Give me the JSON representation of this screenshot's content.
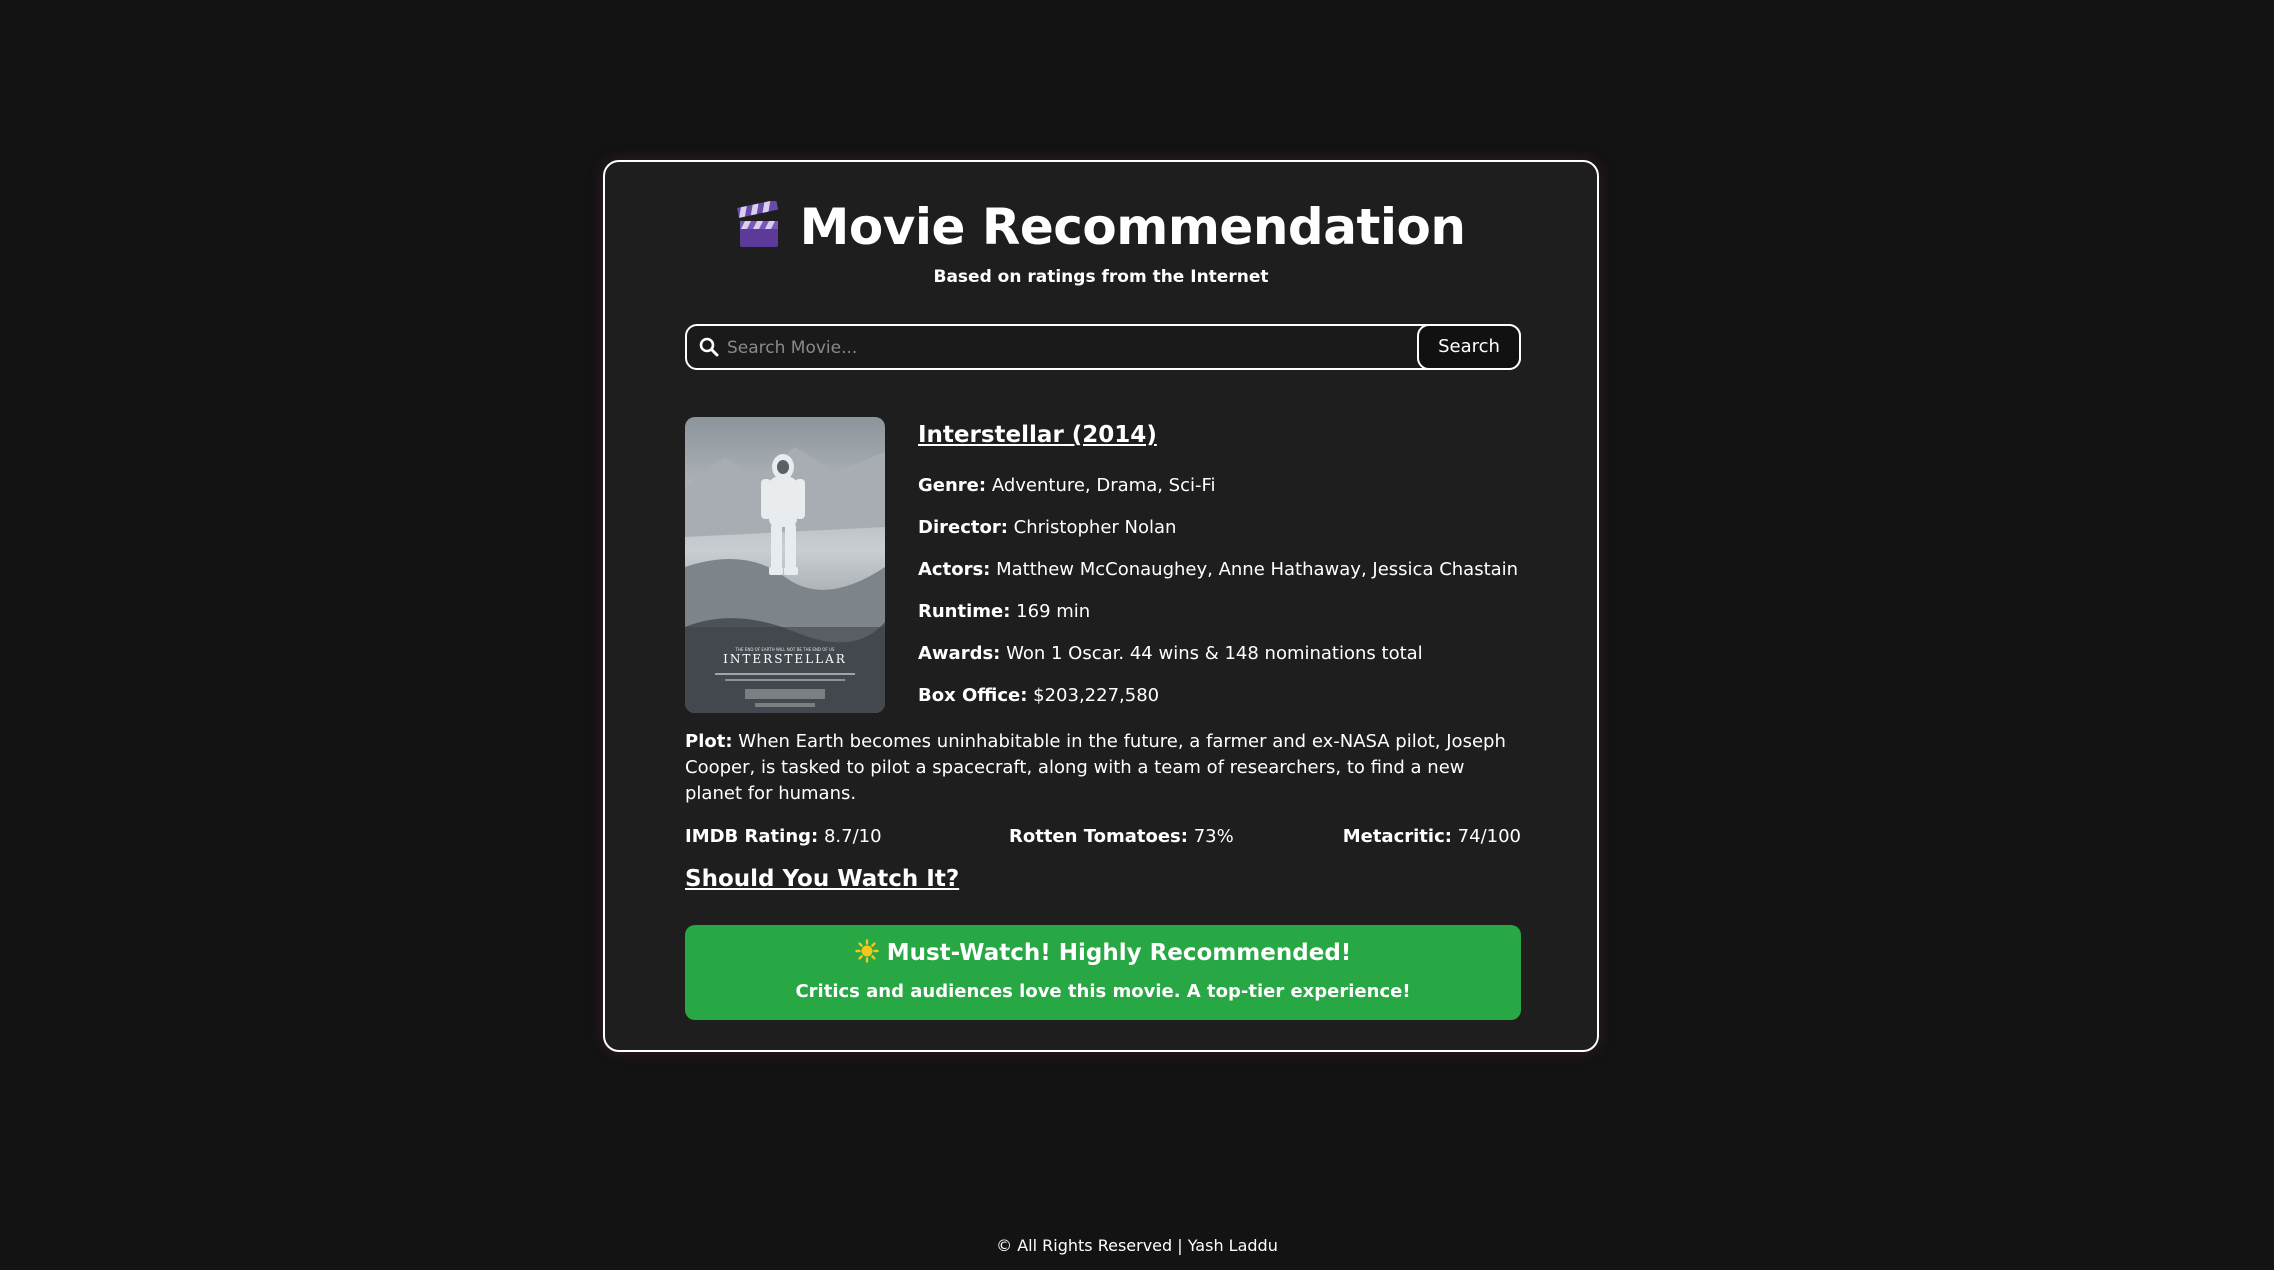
{
  "header": {
    "icon": "clapperboard-icon",
    "title": "Movie Recommendation",
    "subtitle": "Based on ratings from the Internet"
  },
  "search": {
    "placeholder": "Search Movie...",
    "value": "",
    "button_label": "Search"
  },
  "movie": {
    "title": "Interstellar (2014)",
    "poster_wordmark": "INTERSTELLAR",
    "details": [
      {
        "label": "Genre:",
        "value": "Adventure, Drama, Sci-Fi"
      },
      {
        "label": "Director:",
        "value": "Christopher Nolan"
      },
      {
        "label": "Actors:",
        "value": "Matthew McConaughey, Anne Hathaway, Jessica Chastain"
      },
      {
        "label": "Runtime:",
        "value": "169 min"
      },
      {
        "label": "Awards:",
        "value": "Won 1 Oscar. 44 wins & 148 nominations total"
      },
      {
        "label": "Box Office:",
        "value": "$203,227,580"
      }
    ],
    "plot_label": "Plot:",
    "plot": "When Earth becomes uninhabitable in the future, a farmer and ex-NASA pilot, Joseph Cooper, is tasked to pilot a spacecraft, along with a team of researchers, to find a new planet for humans.",
    "ratings": [
      {
        "label": "IMDB Rating:",
        "value": "8.7/10"
      },
      {
        "label": "Rotten Tomatoes:",
        "value": "73%"
      },
      {
        "label": "Metacritic:",
        "value": "74/100"
      }
    ]
  },
  "verdict": {
    "heading": "Should You Watch It?",
    "icon": "sun-icon",
    "title": "Must-Watch! Highly Recommended!",
    "subtitle": "Critics and audiences love this movie. A top-tier experience!",
    "color": "#27a844"
  },
  "footer": {
    "text": "© All Rights Reserved | Yash Laddu"
  }
}
